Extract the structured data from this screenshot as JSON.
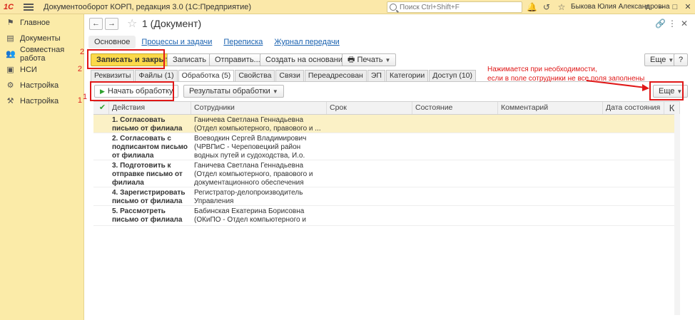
{
  "titlebar": {
    "logo": "1С",
    "title": "Документооборот КОРП, редакция 3.0  (1С:Предприятие)",
    "search_placeholder": "Поиск Ctrl+Shift+F",
    "user": "Быкова Юлия Александровна"
  },
  "sidebar": {
    "items": [
      {
        "label": "Главное",
        "icon": "flag-icon"
      },
      {
        "label": "Документы",
        "icon": "document-icon"
      },
      {
        "label": "Совместная работа",
        "icon": "users-icon"
      },
      {
        "label": "НСИ",
        "icon": "book-icon",
        "num": "2"
      },
      {
        "label": "Настройка",
        "icon": "gear-icon"
      },
      {
        "label": "Настройка",
        "icon": "tools-icon",
        "num": "1"
      }
    ]
  },
  "document": {
    "title": "1 (Документ)",
    "nav_back": "←",
    "nav_forward": "→"
  },
  "subtabs": [
    "Основное",
    "Процессы и задачи",
    "Переписка",
    "Журнал передачи"
  ],
  "toolbar": {
    "save_close": "Записать и закрыть",
    "save": "Записать",
    "send": "Отправить...",
    "create_based": "Создать на основании",
    "print": "Печать",
    "more": "Еще",
    "help": "?"
  },
  "tabs": [
    "Реквизиты",
    "Файлы (1)",
    "Обработка (5)",
    "Свойства",
    "Связи",
    "Переадресован",
    "ЭП",
    "Категории",
    "Доступ (10)"
  ],
  "processing": {
    "start_button": "Начать обработку",
    "results_button": "Результаты обработки",
    "more_button": "Еще"
  },
  "annotation": {
    "line1": "Нажимается при необходимости,",
    "line2": "если в поле сотрудники не все поля заполнены",
    "num1": "1",
    "num2": "2"
  },
  "table": {
    "columns": [
      "Действия",
      "Сотрудники",
      "Срок",
      "Состояние",
      "Комментарий",
      "Дата состояния",
      "К"
    ],
    "rows": [
      {
        "action": "1. Согласовать письмо от филиала",
        "staff": "Ганичева Светлана Геннадьевна (Отдел компьютерного, правового и ..."
      },
      {
        "action": "2. Согласовать с подписантом письмо от филиала",
        "staff": "Воеводкин Сергей Владимирович (ЧРВПиС - Череповецкий район водных путей и судоходства, И.о. начальника филиала)"
      },
      {
        "action": "3. Подготовить к отправке письмо от филиала",
        "staff": "Ганичева Светлана Геннадьевна (Отдел компьютерного, правового и документационного обеспечения (ЧРВПиС)..."
      },
      {
        "action": "4. Зарегистрировать письмо от филиала",
        "staff": "Регистратор-делопроизводитель Управления"
      },
      {
        "action": "5. Рассмотреть письмо от филиала",
        "staff": "Бабинская Екатерина Борисовна (ОКиПО - Отдел компьютерного и программного ..."
      }
    ]
  },
  "colors": {
    "accent": "#fbd94a",
    "sidebar": "#fbeba8",
    "annotation": "#e01818"
  }
}
